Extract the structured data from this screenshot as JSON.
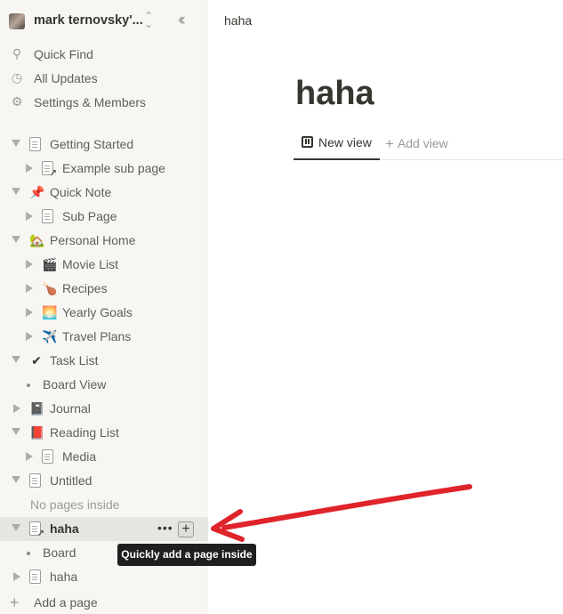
{
  "workspace": {
    "name": "mark ternovsky'...",
    "switch_icon": "chevron-up-down-icon",
    "collapse_icon": "double-chevron-left-icon"
  },
  "nav": {
    "quick_find": "Quick Find",
    "all_updates": "All Updates",
    "settings": "Settings & Members"
  },
  "tree": [
    {
      "label": "Getting Started",
      "icon": "📄",
      "level": 0,
      "toggle": "down",
      "kind": "doc"
    },
    {
      "label": "Example sub page",
      "icon": "📄",
      "level": 1,
      "toggle": "right",
      "kind": "doc-link"
    },
    {
      "label": "Quick Note",
      "icon": "📌",
      "level": 0,
      "toggle": "down",
      "kind": "emoji"
    },
    {
      "label": "Sub Page",
      "icon": "📄",
      "level": 1,
      "toggle": "right",
      "kind": "doc"
    },
    {
      "label": "Personal Home",
      "icon": "🏡",
      "level": 0,
      "toggle": "down",
      "kind": "emoji"
    },
    {
      "label": "Movie List",
      "icon": "🎬",
      "level": 1,
      "toggle": "right",
      "kind": "emoji"
    },
    {
      "label": "Recipes",
      "icon": "🍗",
      "level": 1,
      "toggle": "right",
      "kind": "emoji"
    },
    {
      "label": "Yearly Goals",
      "icon": "🌅",
      "level": 1,
      "toggle": "right",
      "kind": "emoji"
    },
    {
      "label": "Travel Plans",
      "icon": "✈️",
      "level": 1,
      "toggle": "right",
      "kind": "emoji"
    },
    {
      "label": "Task List",
      "icon": "✔",
      "level": 0,
      "toggle": "down",
      "kind": "emoji"
    },
    {
      "label": "Board View",
      "icon": "",
      "level": 1,
      "toggle": "bullet",
      "kind": "none"
    },
    {
      "label": "Journal",
      "icon": "📓",
      "level": 0,
      "toggle": "right",
      "kind": "emoji"
    },
    {
      "label": "Reading List",
      "icon": "📕",
      "level": 0,
      "toggle": "down",
      "kind": "emoji"
    },
    {
      "label": "Media",
      "icon": "📄",
      "level": 1,
      "toggle": "right",
      "kind": "doc"
    },
    {
      "label": "Untitled",
      "icon": "📄",
      "level": 0,
      "toggle": "down",
      "kind": "doc"
    },
    {
      "label": "No pages inside",
      "icon": "",
      "level": 1,
      "toggle": "none",
      "kind": "none"
    },
    {
      "label": "haha",
      "icon": "📄",
      "level": 0,
      "toggle": "down",
      "kind": "doc-link",
      "selected": true
    },
    {
      "label": "Board",
      "icon": "",
      "level": 1,
      "toggle": "bullet",
      "kind": "none"
    },
    {
      "label": "haha",
      "icon": "📄",
      "level": 0,
      "toggle": "right",
      "kind": "doc"
    }
  ],
  "add_page": "Add a page",
  "tooltip": "Quickly add a page inside",
  "main": {
    "breadcrumb": "haha",
    "title": "haha",
    "tabs": {
      "active": "New view",
      "add": "Add view"
    }
  },
  "colors": {
    "sidebar_bg": "#f7f6f3",
    "arrow": "#e0242b",
    "text": "#37352f"
  }
}
